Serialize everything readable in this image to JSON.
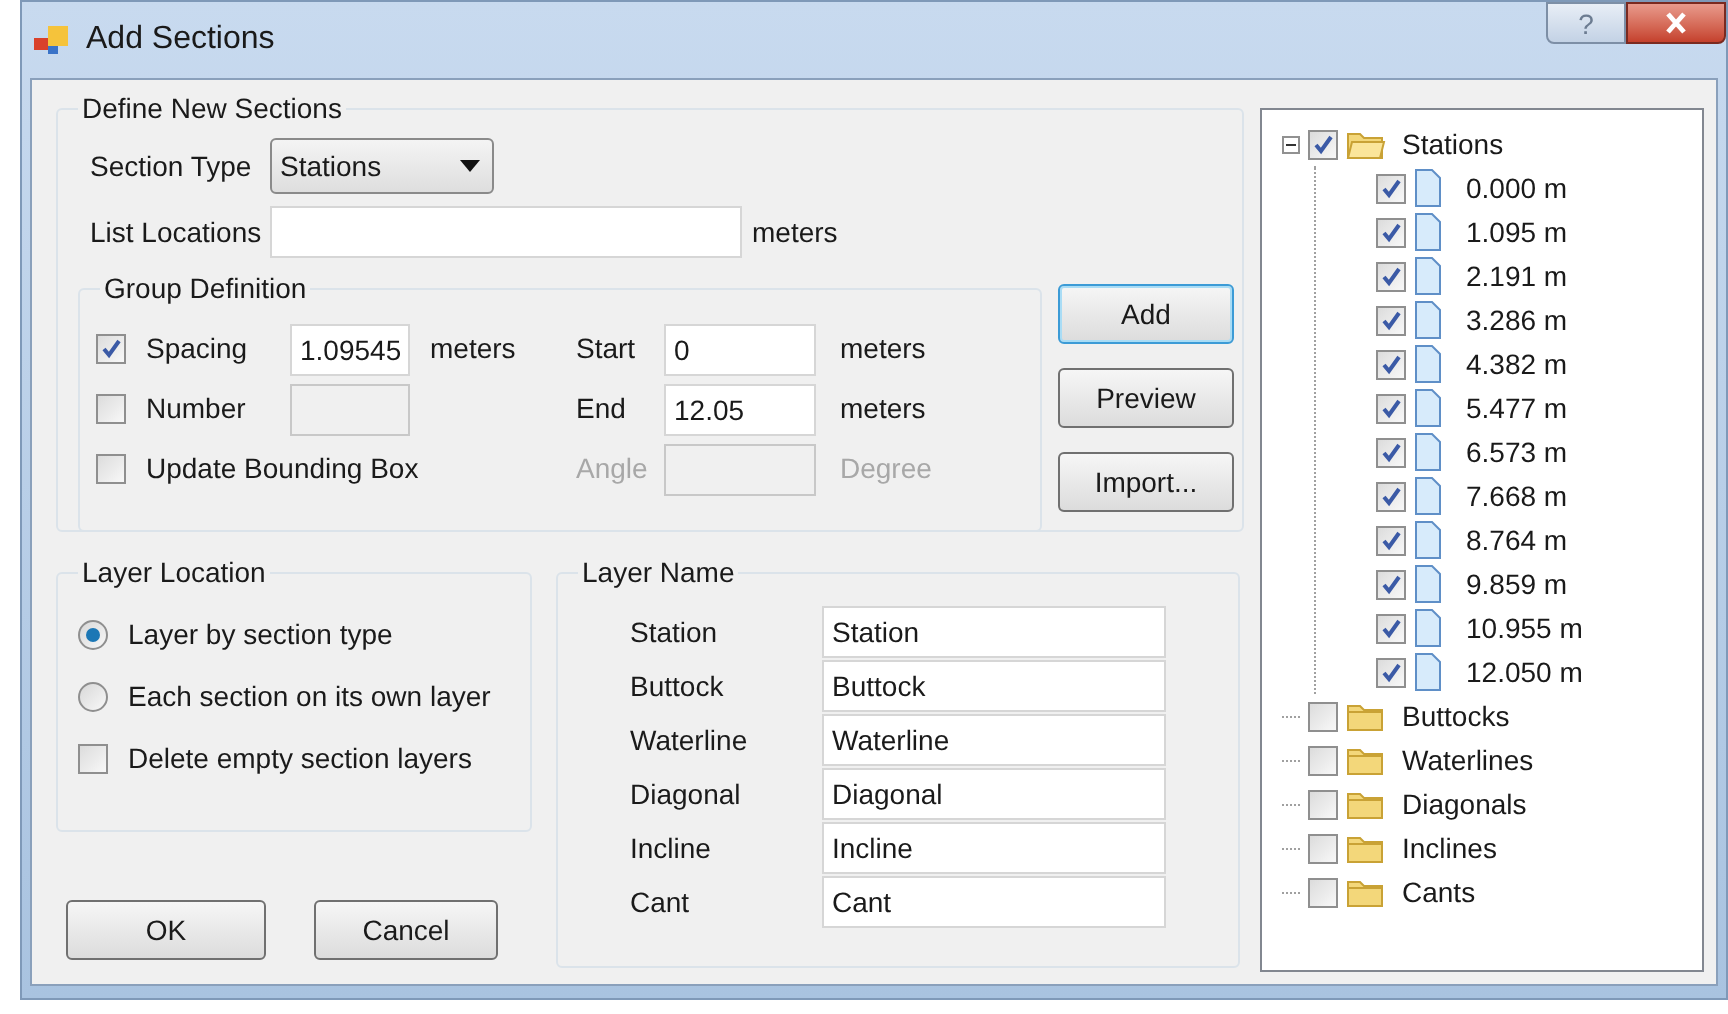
{
  "window": {
    "title": "Add Sections",
    "help_button": "?"
  },
  "define_sections": {
    "legend": "Define New Sections",
    "section_type": {
      "label": "Section Type",
      "value": "Stations"
    },
    "list_locations": {
      "label": "List Locations",
      "unit": "meters"
    },
    "group_definition": {
      "legend": "Group Definition",
      "left_rows": [
        {
          "kind": "field",
          "label": "Spacing",
          "checked": true,
          "value": "1.09545",
          "disabled": false,
          "unit": "meters"
        },
        {
          "kind": "field",
          "label": "Number",
          "checked": false,
          "disabled": true
        },
        {
          "kind": "plain",
          "label": "Update Bounding Box",
          "checked": false
        }
      ],
      "right_rows": [
        {
          "label": "Start",
          "value": "0",
          "unit": "meters",
          "disabled": false
        },
        {
          "label": "End",
          "value": "12.05",
          "unit": "meters",
          "disabled": false
        },
        {
          "label": "Angle",
          "unit": "Degree",
          "disabled": true
        }
      ]
    },
    "buttons": [
      {
        "label": "Add",
        "default": true
      },
      {
        "label": "Preview",
        "default": false
      },
      {
        "label": "Import...",
        "default": false
      }
    ]
  },
  "layer_location": {
    "legend": "Layer Location",
    "options": [
      {
        "kind": "radio",
        "label": "Layer by section type",
        "selected": true
      },
      {
        "kind": "radio",
        "label": "Each section on its own layer",
        "selected": false
      },
      {
        "kind": "checkbox",
        "label": "Delete empty section layers",
        "checked": false
      }
    ]
  },
  "dialog_buttons": [
    "OK",
    "Cancel"
  ],
  "layer_name": {
    "legend": "Layer Name",
    "rows": [
      {
        "label": "Station",
        "value": "Station"
      },
      {
        "label": "Buttock",
        "value": "Buttock"
      },
      {
        "label": "Waterline",
        "value": "Waterline"
      },
      {
        "label": "Diagonal",
        "value": "Diagonal"
      },
      {
        "label": "Incline",
        "value": "Incline"
      },
      {
        "label": "Cant",
        "value": "Cant"
      }
    ]
  },
  "tree": [
    {
      "label": "Stations",
      "checked": true,
      "expanded": true,
      "children": [
        {
          "label": "0.000 m",
          "checked": true
        },
        {
          "label": "1.095 m",
          "checked": true
        },
        {
          "label": "2.191 m",
          "checked": true
        },
        {
          "label": "3.286 m",
          "checked": true
        },
        {
          "label": "4.382 m",
          "checked": true
        },
        {
          "label": "5.477 m",
          "checked": true
        },
        {
          "label": "6.573 m",
          "checked": true
        },
        {
          "label": "7.668 m",
          "checked": true
        },
        {
          "label": "8.764 m",
          "checked": true
        },
        {
          "label": "9.859 m",
          "checked": true
        },
        {
          "label": "10.955 m",
          "checked": true
        },
        {
          "label": "12.050 m",
          "checked": true
        }
      ]
    },
    {
      "label": "Buttocks",
      "checked": false,
      "expanded": false
    },
    {
      "label": "Waterlines",
      "checked": false,
      "expanded": false
    },
    {
      "label": "Diagonals",
      "checked": false,
      "expanded": false
    },
    {
      "label": "Inclines",
      "checked": false,
      "expanded": false
    },
    {
      "label": "Cants",
      "checked": false,
      "expanded": false
    }
  ]
}
